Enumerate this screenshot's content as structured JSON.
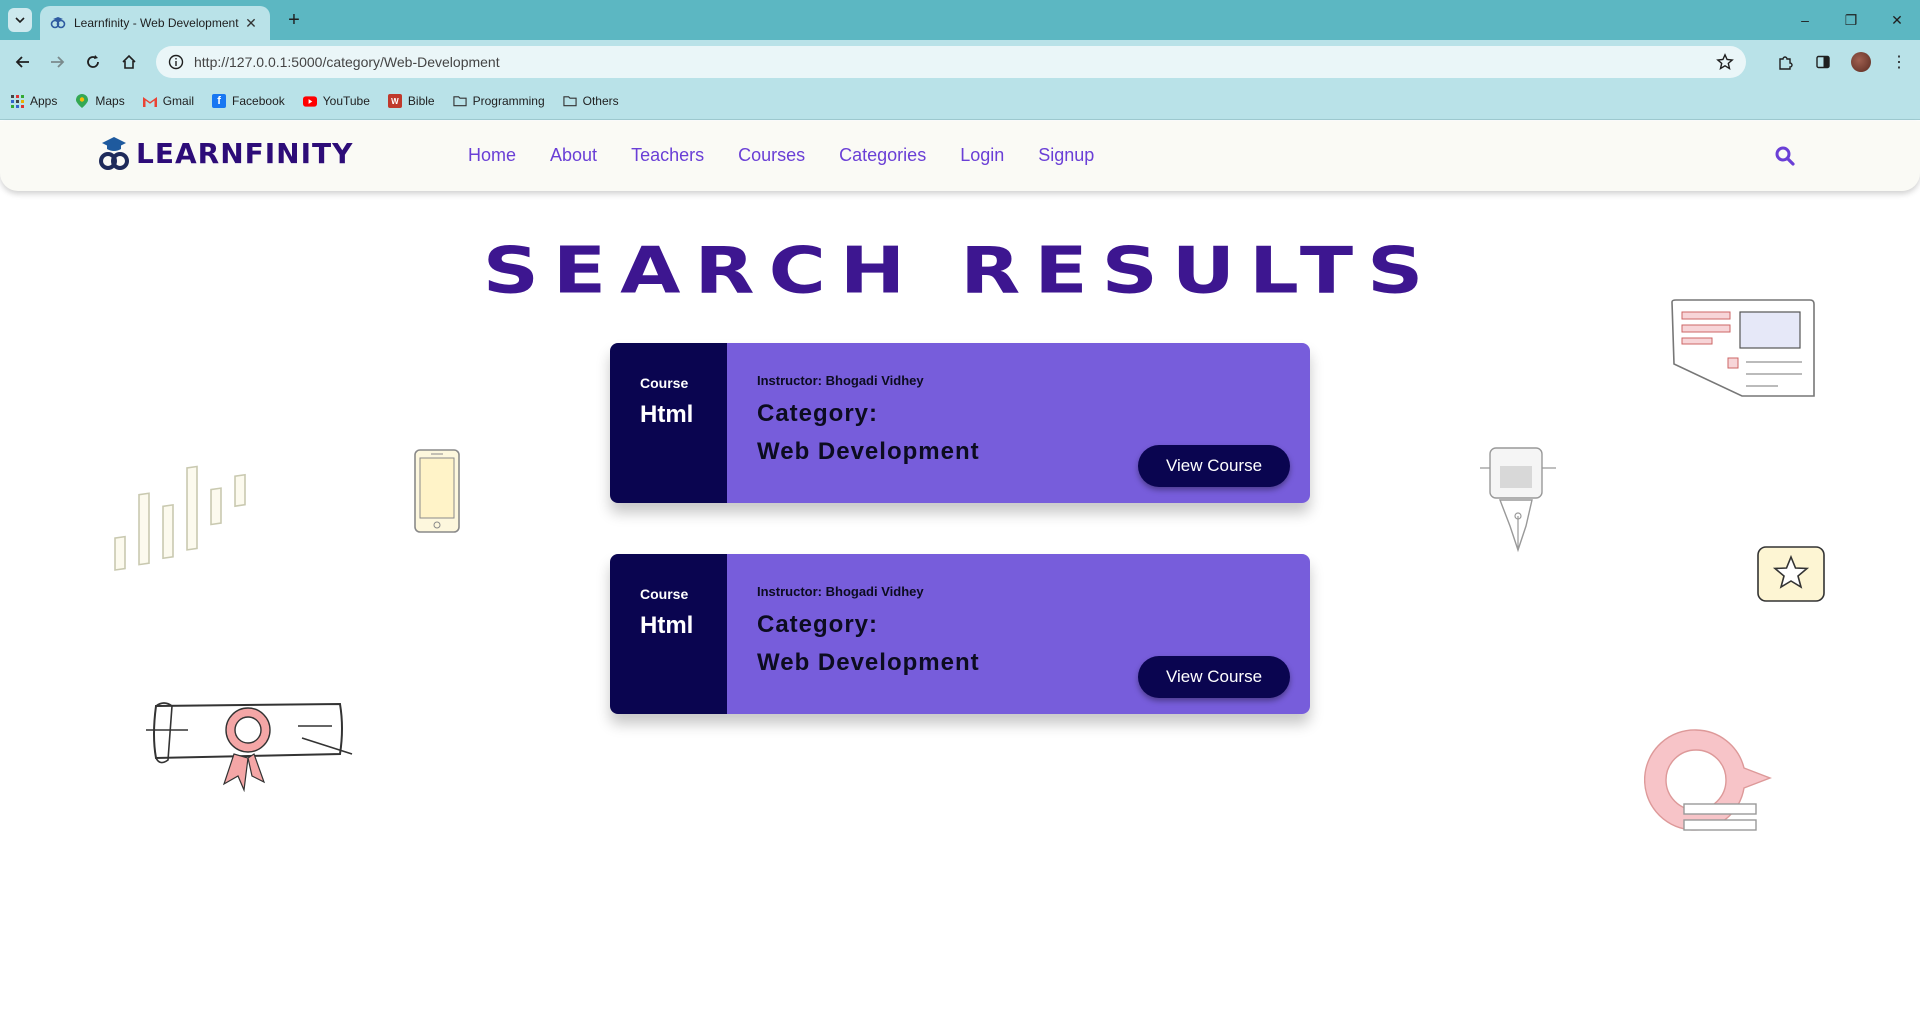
{
  "browser": {
    "tab_title": "Learnfinity - Web Development",
    "url": "http://127.0.0.1:5000/category/Web-Development",
    "bookmarks": [
      {
        "label": "Apps",
        "icon": "apps-grid-icon"
      },
      {
        "label": "Maps",
        "icon": "maps-pin-icon"
      },
      {
        "label": "Gmail",
        "icon": "gmail-icon"
      },
      {
        "label": "Facebook",
        "icon": "facebook-icon"
      },
      {
        "label": "YouTube",
        "icon": "youtube-icon"
      },
      {
        "label": "Bible",
        "icon": "bible-icon"
      },
      {
        "label": "Programming",
        "icon": "folder-icon"
      },
      {
        "label": "Others",
        "icon": "folder-icon"
      }
    ]
  },
  "header": {
    "logo_text": "LEARNFINITY",
    "nav": [
      "Home",
      "About",
      "Teachers",
      "Courses",
      "Categories",
      "Login",
      "Signup"
    ]
  },
  "main": {
    "title": "Search Results",
    "cards": [
      {
        "side_label": "Course",
        "course_name": "Html",
        "instructor": "Instructor: Bhogadi Vidhey",
        "category_label": "Category:",
        "category_value": "Web Development",
        "button": "View Course"
      },
      {
        "side_label": "Course",
        "course_name": "Html",
        "instructor": "Instructor: Bhogadi Vidhey",
        "category_label": "Category:",
        "category_value": "Web Development",
        "button": "View Course"
      }
    ]
  },
  "colors": {
    "chrome_tabstrip": "#5cb7c2",
    "chrome_toolbar": "#b9e2e8",
    "brand_dark": "#0a0550",
    "brand_purple": "#775ddb",
    "nav_link": "#6a3fd6",
    "title": "#3d1690"
  }
}
